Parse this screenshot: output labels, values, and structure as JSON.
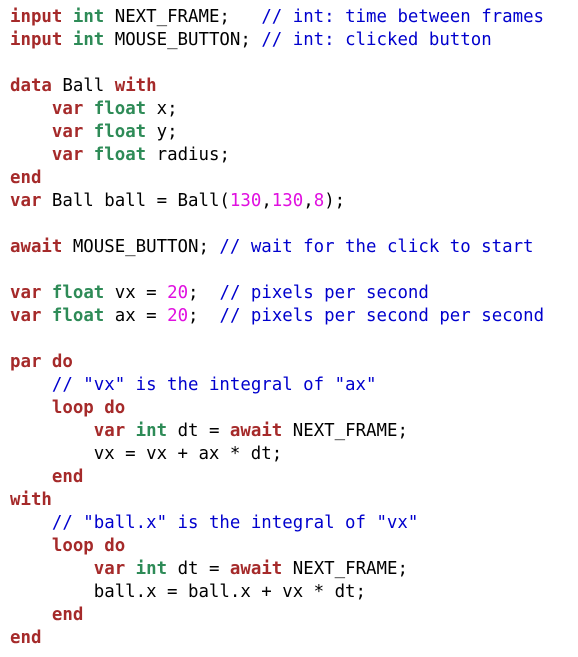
{
  "colors": {
    "keyword": "#a52a2a",
    "type": "#2e8b57",
    "comment": "#0000cd",
    "number": "#e010e0",
    "text": "#000000"
  },
  "code_lines": [
    [
      [
        "keyword",
        "input"
      ],
      [
        "text",
        " "
      ],
      [
        "type",
        "int"
      ],
      [
        "text",
        " NEXT_FRAME;   "
      ],
      [
        "comment",
        "// int: time between frames"
      ]
    ],
    [
      [
        "keyword",
        "input"
      ],
      [
        "text",
        " "
      ],
      [
        "type",
        "int"
      ],
      [
        "text",
        " MOUSE_BUTTON; "
      ],
      [
        "comment",
        "// int: clicked button"
      ]
    ],
    [],
    [
      [
        "keyword",
        "data"
      ],
      [
        "text",
        " Ball "
      ],
      [
        "keyword",
        "with"
      ]
    ],
    [
      [
        "text",
        "    "
      ],
      [
        "keyword",
        "var"
      ],
      [
        "text",
        " "
      ],
      [
        "type",
        "float"
      ],
      [
        "text",
        " x;"
      ]
    ],
    [
      [
        "text",
        "    "
      ],
      [
        "keyword",
        "var"
      ],
      [
        "text",
        " "
      ],
      [
        "type",
        "float"
      ],
      [
        "text",
        " y;"
      ]
    ],
    [
      [
        "text",
        "    "
      ],
      [
        "keyword",
        "var"
      ],
      [
        "text",
        " "
      ],
      [
        "type",
        "float"
      ],
      [
        "text",
        " radius;"
      ]
    ],
    [
      [
        "keyword",
        "end"
      ]
    ],
    [
      [
        "keyword",
        "var"
      ],
      [
        "text",
        " Ball ball = Ball("
      ],
      [
        "number",
        "130"
      ],
      [
        "text",
        ","
      ],
      [
        "number",
        "130"
      ],
      [
        "text",
        ","
      ],
      [
        "number",
        "8"
      ],
      [
        "text",
        ");"
      ]
    ],
    [],
    [
      [
        "keyword",
        "await"
      ],
      [
        "text",
        " MOUSE_BUTTON; "
      ],
      [
        "comment",
        "// wait for the click to start"
      ]
    ],
    [],
    [
      [
        "keyword",
        "var"
      ],
      [
        "text",
        " "
      ],
      [
        "type",
        "float"
      ],
      [
        "text",
        " vx = "
      ],
      [
        "number",
        "20"
      ],
      [
        "text",
        ";  "
      ],
      [
        "comment",
        "// pixels per second"
      ]
    ],
    [
      [
        "keyword",
        "var"
      ],
      [
        "text",
        " "
      ],
      [
        "type",
        "float"
      ],
      [
        "text",
        " ax = "
      ],
      [
        "number",
        "20"
      ],
      [
        "text",
        ";  "
      ],
      [
        "comment",
        "// pixels per second per second"
      ]
    ],
    [],
    [
      [
        "keyword",
        "par"
      ],
      [
        "text",
        " "
      ],
      [
        "keyword",
        "do"
      ]
    ],
    [
      [
        "text",
        "    "
      ],
      [
        "comment",
        "// \"vx\" is the integral of \"ax\""
      ]
    ],
    [
      [
        "text",
        "    "
      ],
      [
        "keyword",
        "loop"
      ],
      [
        "text",
        " "
      ],
      [
        "keyword",
        "do"
      ]
    ],
    [
      [
        "text",
        "        "
      ],
      [
        "keyword",
        "var"
      ],
      [
        "text",
        " "
      ],
      [
        "type",
        "int"
      ],
      [
        "text",
        " dt = "
      ],
      [
        "keyword",
        "await"
      ],
      [
        "text",
        " NEXT_FRAME;"
      ]
    ],
    [
      [
        "text",
        "        vx = vx + ax * dt;"
      ]
    ],
    [
      [
        "text",
        "    "
      ],
      [
        "keyword",
        "end"
      ]
    ],
    [
      [
        "keyword",
        "with"
      ]
    ],
    [
      [
        "text",
        "    "
      ],
      [
        "comment",
        "// \"ball.x\" is the integral of \"vx\""
      ]
    ],
    [
      [
        "text",
        "    "
      ],
      [
        "keyword",
        "loop"
      ],
      [
        "text",
        " "
      ],
      [
        "keyword",
        "do"
      ]
    ],
    [
      [
        "text",
        "        "
      ],
      [
        "keyword",
        "var"
      ],
      [
        "text",
        " "
      ],
      [
        "type",
        "int"
      ],
      [
        "text",
        " dt = "
      ],
      [
        "keyword",
        "await"
      ],
      [
        "text",
        " NEXT_FRAME;"
      ]
    ],
    [
      [
        "text",
        "        ball.x = ball.x + vx * dt;"
      ]
    ],
    [
      [
        "text",
        "    "
      ],
      [
        "keyword",
        "end"
      ]
    ],
    [
      [
        "keyword",
        "end"
      ]
    ]
  ]
}
